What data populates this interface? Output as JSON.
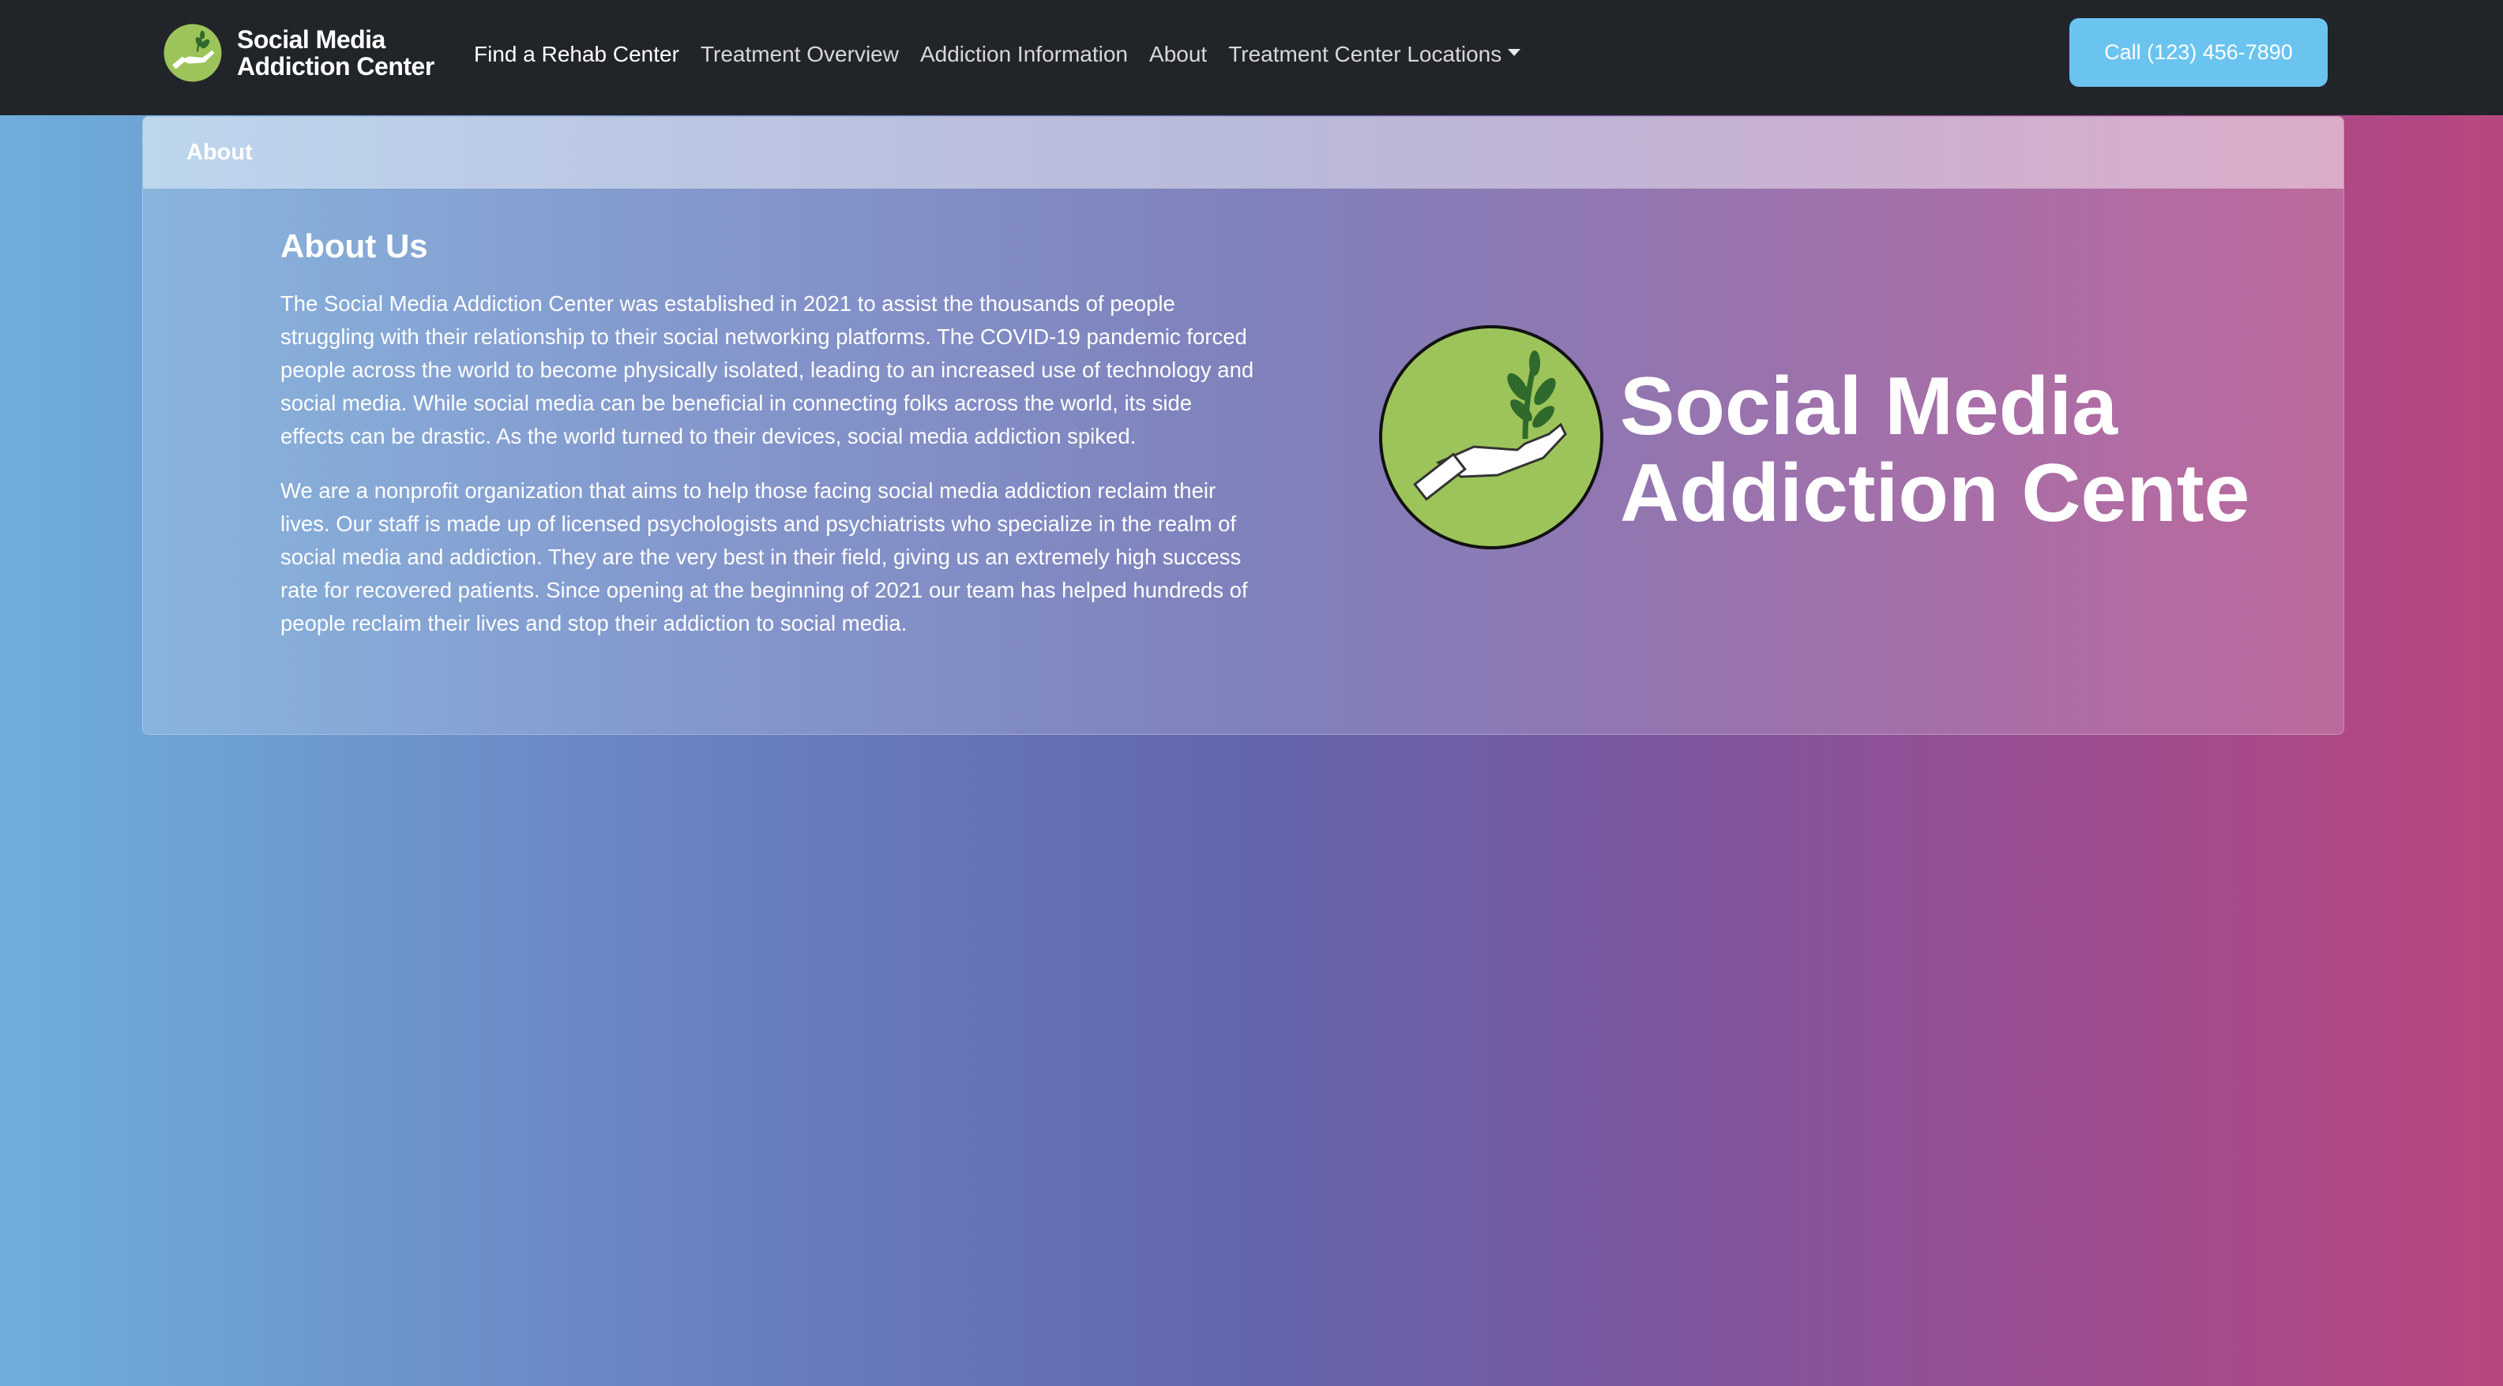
{
  "brand": {
    "line1": "Social Media",
    "line2": "Addiction Center",
    "logo_icon": "hand-holding-plant-icon"
  },
  "nav": {
    "items": [
      {
        "label": "Find a Rehab Center",
        "active": true
      },
      {
        "label": "Treatment Overview",
        "active": false
      },
      {
        "label": "Addiction Information",
        "active": false
      },
      {
        "label": "About",
        "active": false
      },
      {
        "label": "Treatment Center Locations",
        "active": false,
        "dropdown": true
      }
    ],
    "call_button": "Call (123) 456-7890"
  },
  "card": {
    "header": "About",
    "title": "About Us",
    "paragraphs": [
      "The Social Media Addiction Center was established in 2021 to assist the thousands of people struggling with their relationship to their social networking platforms. The COVID-19 pandemic forced people across the world to become physically isolated, leading to an increased use of technology and social media. While social media can be beneficial in connecting folks across the world, its side effects can be drastic. As the world turned to their devices, social media addiction spiked.",
      "We are a nonprofit organization that aims to help those facing social media addiction reclaim their lives. Our staff is made up of licensed psychologists and psychiatrists who specialize in the realm of social media and addiction. They are the very best in their field, giving us an extremely high success rate for recovered patients. Since opening at the beginning of 2021 our team has helped hundreds of people reclaim their lives and stop their addiction to social media."
    ],
    "logo": {
      "line1": "Social Media",
      "line2": "Addiction Center"
    }
  },
  "colors": {
    "navbar": "#212529",
    "call_button": "#6ac4ef",
    "logo_green": "#9cc45a",
    "leaf_green": "#2f6a2c"
  }
}
